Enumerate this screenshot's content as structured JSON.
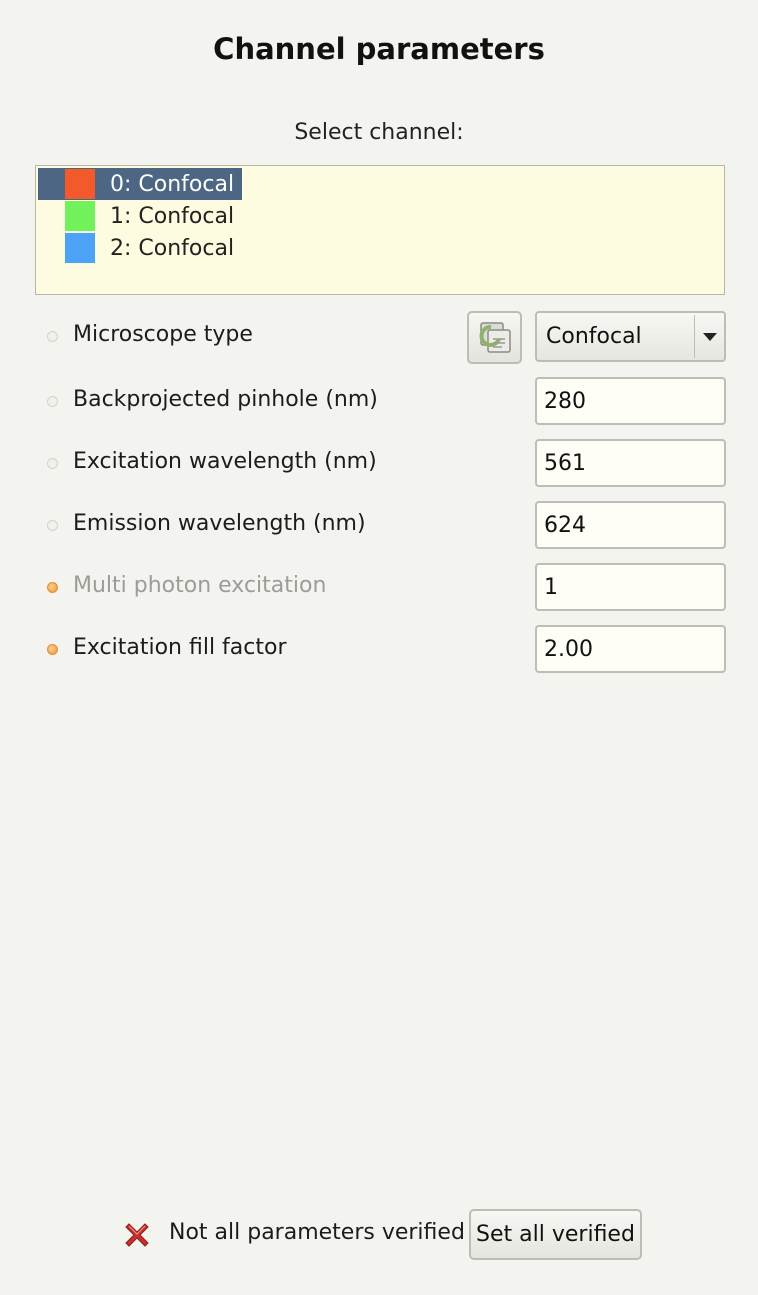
{
  "panel": {
    "title": "Channel parameters",
    "select_label": "Select channel:"
  },
  "channels": [
    {
      "label": "0: Confocal",
      "color": "#f25a2b",
      "selected": true
    },
    {
      "label": "1: Confocal",
      "color": "#72f25a",
      "selected": false
    },
    {
      "label": "2: Confocal",
      "color": "#4da3f5",
      "selected": false
    }
  ],
  "params": {
    "microscope_type": {
      "label": "Microscope type",
      "value": "Confocal",
      "status": "unverified"
    },
    "pinhole": {
      "label": "Backprojected pinhole (nm)",
      "value": "280",
      "status": "unverified"
    },
    "excitation": {
      "label": "Excitation wavelength (nm)",
      "value": "561",
      "status": "unverified"
    },
    "emission": {
      "label": "Emission wavelength (nm)",
      "value": "624",
      "status": "unverified"
    },
    "multi_photon": {
      "label": "Multi photon excitation",
      "value": "1",
      "status": "verified",
      "disabled": true
    },
    "fill_factor": {
      "label": "Excitation fill factor",
      "value": "2.00",
      "status": "verified"
    }
  },
  "footer": {
    "status_text": "Not all parameters verified",
    "set_verified_label": "Set all verified",
    "status_icon": "red-x-icon"
  },
  "colors": {
    "selection": "#4c6684",
    "list_bg": "#fefce0",
    "verified_dot": "#f1a348",
    "error_x": "#c8302b"
  }
}
